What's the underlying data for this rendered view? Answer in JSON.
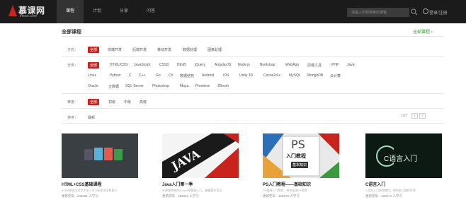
{
  "header": {
    "logo_text": "慕课网",
    "logo_sub": "imooc.com",
    "nav": [
      "课程",
      "计划",
      "分享",
      "问答"
    ],
    "search_placeholder": "请输入你想搜索的课程",
    "user_link": "登录/注册"
  },
  "page": {
    "title": "全部课程",
    "right_link": "全部课程 ›"
  },
  "filters": {
    "direction": {
      "label": "方向：",
      "tags": [
        "全部",
        "前端开发",
        "后端开发",
        "移动开发",
        "数据处理",
        "图像处理"
      ]
    },
    "category": {
      "label": "分类：",
      "rows": [
        [
          "全部",
          "HTML/CSS",
          "JavaScript",
          "CSS3",
          "Html5",
          "jQuery",
          "AngularJS",
          "Node.js",
          "Bootstrap",
          "WebApp",
          "前端工具",
          "PHP",
          "Java"
        ],
        [
          "Linux",
          "Python",
          "C",
          "C++",
          "Go",
          "C#",
          "数据结构",
          "Android",
          "iOS",
          "Unity 3D",
          "Cocos2d-x",
          "MySQL",
          "MongoDB",
          "云计算"
        ],
        [
          "Oracle",
          "大数据",
          "SQL Server",
          "Photoshop",
          "Maya",
          "Premiere",
          "ZBrush"
        ]
      ]
    },
    "difficulty": {
      "label": "难度：",
      "tags": [
        "全部",
        "初级",
        "中级",
        "高级"
      ]
    },
    "sort": {
      "label": "排序：",
      "value": "最新"
    }
  },
  "pagination": {
    "text": "1/27",
    "prev": "‹",
    "next": "›"
  },
  "courses": [
    {
      "title": "HTML+CSS基础课程",
      "desc": "8小时带领大家步步深入学习标签用法和意义",
      "meta": "更新完毕 · 209281 人学习"
    },
    {
      "title": "Java入门第一季",
      "desc": "本课程将带你从Java零基础入门，掌握基本语法",
      "meta": "更新完毕 · 150861 人学习"
    },
    {
      "title": "PS入门教程——基础知识",
      "desc": "PS基础入门教程，带你走进PS世界",
      "meta": "更新完毕 · 160578 人学习"
    },
    {
      "title": "C语言入门",
      "desc": "C语言入门视频教程，带你进入编程世界",
      "meta": "更新完毕 · 180274 人学习"
    }
  ],
  "card_art": {
    "java_word": "JAVA",
    "ps_word": "PS",
    "ps_caption": "入门教程",
    "ps_sub": "基本知识",
    "c_word": "C语言入门"
  },
  "colors": {
    "brand_red": "#c9231d",
    "accent_green": "#2b9a2b",
    "topbar_bg": "#1b1b1b"
  }
}
